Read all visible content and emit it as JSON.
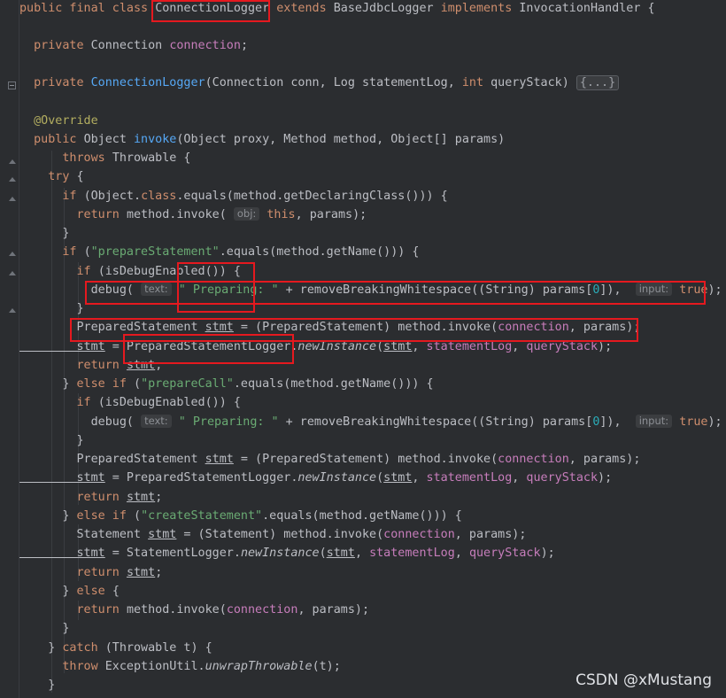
{
  "editor": {
    "lines": [
      {
        "t": "l0",
        "parts": [
          [
            "kw",
            "public final class "
          ],
          [
            "",
            "ConnectionLogger"
          ],
          [
            "kw",
            " extends "
          ],
          [
            "",
            "BaseJdbcLogger "
          ],
          [
            "kw",
            "implements "
          ],
          [
            "",
            "InvocationHandler {"
          ]
        ]
      },
      {
        "t": "l1",
        "parts": []
      },
      {
        "t": "l2",
        "parts": [
          [
            "kw",
            "  private "
          ],
          [
            "",
            "Connection "
          ],
          [
            "fld",
            "connection"
          ],
          [
            "",
            ";"
          ]
        ]
      },
      {
        "t": "l3",
        "parts": []
      },
      {
        "t": "l4",
        "parts": [
          [
            "kw",
            "  private "
          ],
          [
            "mth",
            "ConnectionLogger"
          ],
          [
            "",
            "(Connection conn, Log statementLog, "
          ],
          [
            "kw",
            "int "
          ],
          [
            "",
            "queryStack) "
          ],
          [
            "chip",
            "{...}"
          ]
        ]
      },
      {
        "t": "l5",
        "parts": []
      },
      {
        "t": "l6",
        "parts": [
          [
            "ann",
            "  @Override"
          ]
        ]
      },
      {
        "t": "l7",
        "parts": [
          [
            "kw",
            "  public "
          ],
          [
            "",
            "Object "
          ],
          [
            "mth",
            "invoke"
          ],
          [
            "",
            "(Object proxy, Method method, Object[] params)"
          ]
        ]
      },
      {
        "t": "l8",
        "parts": [
          [
            "kw",
            "      throws "
          ],
          [
            "",
            "Throwable {"
          ]
        ]
      },
      {
        "t": "l9",
        "parts": [
          [
            "kw",
            "    try "
          ],
          [
            "",
            "{"
          ]
        ]
      },
      {
        "t": "l10",
        "parts": [
          [
            "kw",
            "      if "
          ],
          [
            "",
            "(Object."
          ],
          [
            "kw",
            "class"
          ],
          [
            "",
            ".equals(method.getDeclaringClass())) {"
          ]
        ]
      },
      {
        "t": "l11",
        "parts": [
          [
            "kw",
            "        return "
          ],
          [
            "",
            "method.invoke( "
          ],
          [
            "hint",
            "obj:"
          ],
          [
            "",
            " "
          ],
          [
            "kw",
            "this"
          ],
          [
            "",
            ", params);"
          ]
        ]
      },
      {
        "t": "l12",
        "parts": [
          [
            "",
            "      }"
          ]
        ]
      },
      {
        "t": "l13",
        "parts": [
          [
            "kw",
            "      if "
          ],
          [
            "",
            "("
          ],
          [
            "str",
            "\"prepareStatement\""
          ],
          [
            "",
            ".equals(method.getName())) {"
          ]
        ]
      },
      {
        "t": "l14",
        "parts": [
          [
            "kw",
            "        if "
          ],
          [
            "",
            "(isDebugEnabled()) {"
          ]
        ]
      },
      {
        "t": "l15",
        "parts": [
          [
            "",
            "          debug( "
          ],
          [
            "hint",
            "text:"
          ],
          [
            "",
            " "
          ],
          [
            "str",
            "\" Preparing: \""
          ],
          [
            "",
            " + removeBreakingWhitespace((String) params["
          ],
          [
            "num",
            "0"
          ],
          [
            "",
            "]),  "
          ],
          [
            "hint",
            "input:"
          ],
          [
            "",
            " "
          ],
          [
            "kw",
            "true"
          ],
          [
            "",
            ");"
          ]
        ]
      },
      {
        "t": "l16",
        "parts": [
          [
            "",
            "        }"
          ]
        ]
      },
      {
        "t": "l17",
        "parts": [
          [
            "",
            "        PreparedStatement "
          ],
          [
            "und",
            "stmt"
          ],
          [
            "",
            " = (PreparedStatement) method.invoke("
          ],
          [
            "fld",
            "connection"
          ],
          [
            "",
            ", params);"
          ]
        ]
      },
      {
        "t": "l18",
        "parts": [
          [
            "und",
            "        stmt"
          ],
          [
            "",
            " = PreparedStatementLogger."
          ],
          [
            "ital",
            "newInstance"
          ],
          [
            "",
            "("
          ],
          [
            "und",
            "stmt"
          ],
          [
            "",
            ", "
          ],
          [
            "fld",
            "statementLog"
          ],
          [
            "",
            ", "
          ],
          [
            "fld",
            "queryStack"
          ],
          [
            "",
            ");"
          ]
        ]
      },
      {
        "t": "l19",
        "parts": [
          [
            "kw",
            "        return "
          ],
          [
            "und",
            "stmt"
          ],
          [
            "",
            ";"
          ]
        ]
      },
      {
        "t": "l20",
        "parts": [
          [
            "",
            "      } "
          ],
          [
            "kw",
            "else if "
          ],
          [
            "",
            "("
          ],
          [
            "str",
            "\"prepareCall\""
          ],
          [
            "",
            ".equals(method.getName())) {"
          ]
        ]
      },
      {
        "t": "l21",
        "parts": [
          [
            "kw",
            "        if "
          ],
          [
            "",
            "(isDebugEnabled()) {"
          ]
        ]
      },
      {
        "t": "l22",
        "parts": [
          [
            "",
            "          debug( "
          ],
          [
            "hint",
            "text:"
          ],
          [
            "",
            " "
          ],
          [
            "str",
            "\" Preparing: \""
          ],
          [
            "",
            " + removeBreakingWhitespace((String) params["
          ],
          [
            "num",
            "0"
          ],
          [
            "",
            "]),  "
          ],
          [
            "hint",
            "input:"
          ],
          [
            "",
            " "
          ],
          [
            "kw",
            "true"
          ],
          [
            "",
            ");"
          ]
        ]
      },
      {
        "t": "l23",
        "parts": [
          [
            "",
            "        }"
          ]
        ]
      },
      {
        "t": "l24",
        "parts": [
          [
            "",
            "        PreparedStatement "
          ],
          [
            "und",
            "stmt"
          ],
          [
            "",
            " = (PreparedStatement) method.invoke("
          ],
          [
            "fld",
            "connection"
          ],
          [
            "",
            ", params);"
          ]
        ]
      },
      {
        "t": "l25",
        "parts": [
          [
            "und",
            "        stmt"
          ],
          [
            "",
            " = PreparedStatementLogger."
          ],
          [
            "ital",
            "newInstance"
          ],
          [
            "",
            "("
          ],
          [
            "und",
            "stmt"
          ],
          [
            "",
            ", "
          ],
          [
            "fld",
            "statementLog"
          ],
          [
            "",
            ", "
          ],
          [
            "fld",
            "queryStack"
          ],
          [
            "",
            ");"
          ]
        ]
      },
      {
        "t": "l26",
        "parts": [
          [
            "kw",
            "        return "
          ],
          [
            "und",
            "stmt"
          ],
          [
            "",
            ";"
          ]
        ]
      },
      {
        "t": "l27",
        "parts": [
          [
            "",
            "      } "
          ],
          [
            "kw",
            "else if "
          ],
          [
            "",
            "("
          ],
          [
            "str",
            "\"createStatement\""
          ],
          [
            "",
            ".equals(method.getName())) {"
          ]
        ]
      },
      {
        "t": "l28",
        "parts": [
          [
            "",
            "        Statement "
          ],
          [
            "und",
            "stmt"
          ],
          [
            "",
            " = (Statement) method.invoke("
          ],
          [
            "fld",
            "connection"
          ],
          [
            "",
            ", params);"
          ]
        ]
      },
      {
        "t": "l29",
        "parts": [
          [
            "und",
            "        stmt"
          ],
          [
            "",
            " = StatementLogger."
          ],
          [
            "ital",
            "newInstance"
          ],
          [
            "",
            "("
          ],
          [
            "und",
            "stmt"
          ],
          [
            "",
            ", "
          ],
          [
            "fld",
            "statementLog"
          ],
          [
            "",
            ", "
          ],
          [
            "fld",
            "queryStack"
          ],
          [
            "",
            ");"
          ]
        ]
      },
      {
        "t": "l30",
        "parts": [
          [
            "kw",
            "        return "
          ],
          [
            "und",
            "stmt"
          ],
          [
            "",
            ";"
          ]
        ]
      },
      {
        "t": "l31",
        "parts": [
          [
            "",
            "      } "
          ],
          [
            "kw",
            "else "
          ],
          [
            "",
            "{"
          ]
        ]
      },
      {
        "t": "l32",
        "parts": [
          [
            "kw",
            "        return "
          ],
          [
            "",
            "method.invoke("
          ],
          [
            "fld",
            "connection"
          ],
          [
            "",
            ", params);"
          ]
        ]
      },
      {
        "t": "l33",
        "parts": [
          [
            "",
            "      }"
          ]
        ]
      },
      {
        "t": "l34",
        "parts": [
          [
            "",
            "    } "
          ],
          [
            "kw",
            "catch "
          ],
          [
            "",
            "(Throwable t) {"
          ]
        ]
      },
      {
        "t": "l35",
        "parts": [
          [
            "kw",
            "      throw "
          ],
          [
            "",
            "ExceptionUtil."
          ],
          [
            "ital",
            "unwrapThrowable"
          ],
          [
            "",
            "(t);"
          ]
        ]
      },
      {
        "t": "l36",
        "parts": [
          [
            "",
            "    }"
          ]
        ]
      }
    ]
  },
  "watermark": "CSDN @xMustang",
  "colors": {
    "highlight_box": "#e5191f",
    "background": "#2b2d30"
  }
}
